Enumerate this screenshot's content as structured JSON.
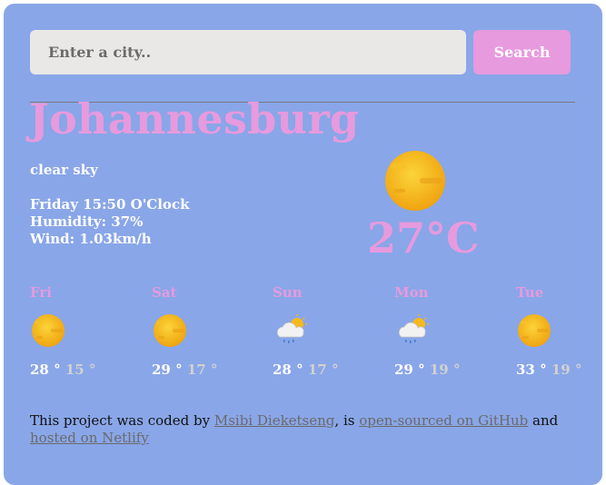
{
  "search": {
    "placeholder": "Enter a city..",
    "button_label": "Search"
  },
  "current": {
    "city": "Johannesburg",
    "description": "clear sky",
    "datetime": "Friday 15:50 O'Clock",
    "humidity": "Humidity: 37%",
    "wind": "Wind: 1.03km/h",
    "temperature": "27°C",
    "icon": "sun-icon"
  },
  "forecast": [
    {
      "day": "Fri",
      "icon": "sun-icon",
      "max": "28 °",
      "min": "15 °"
    },
    {
      "day": "Sat",
      "icon": "sun-icon",
      "max": "29 °",
      "min": "17 °"
    },
    {
      "day": "Sun",
      "icon": "rain-cloud-sun-icon",
      "max": "28 °",
      "min": "17 °"
    },
    {
      "day": "Mon",
      "icon": "rain-cloud-sun-icon",
      "max": "29 °",
      "min": "19 °"
    },
    {
      "day": "Tue",
      "icon": "sun-icon",
      "max": "33 °",
      "min": "19 °"
    }
  ],
  "footer": {
    "text_1": "This project was coded by ",
    "author_link": "Msibi Dieketseng",
    "text_2": ", is ",
    "github_link": "open-sourced on GitHub",
    "text_3": " and ",
    "netlify_link": "hosted on Netlify"
  },
  "colors": {
    "background": "#89a6e8",
    "accent": "#e79ade",
    "input_bg": "#eae8e6"
  }
}
